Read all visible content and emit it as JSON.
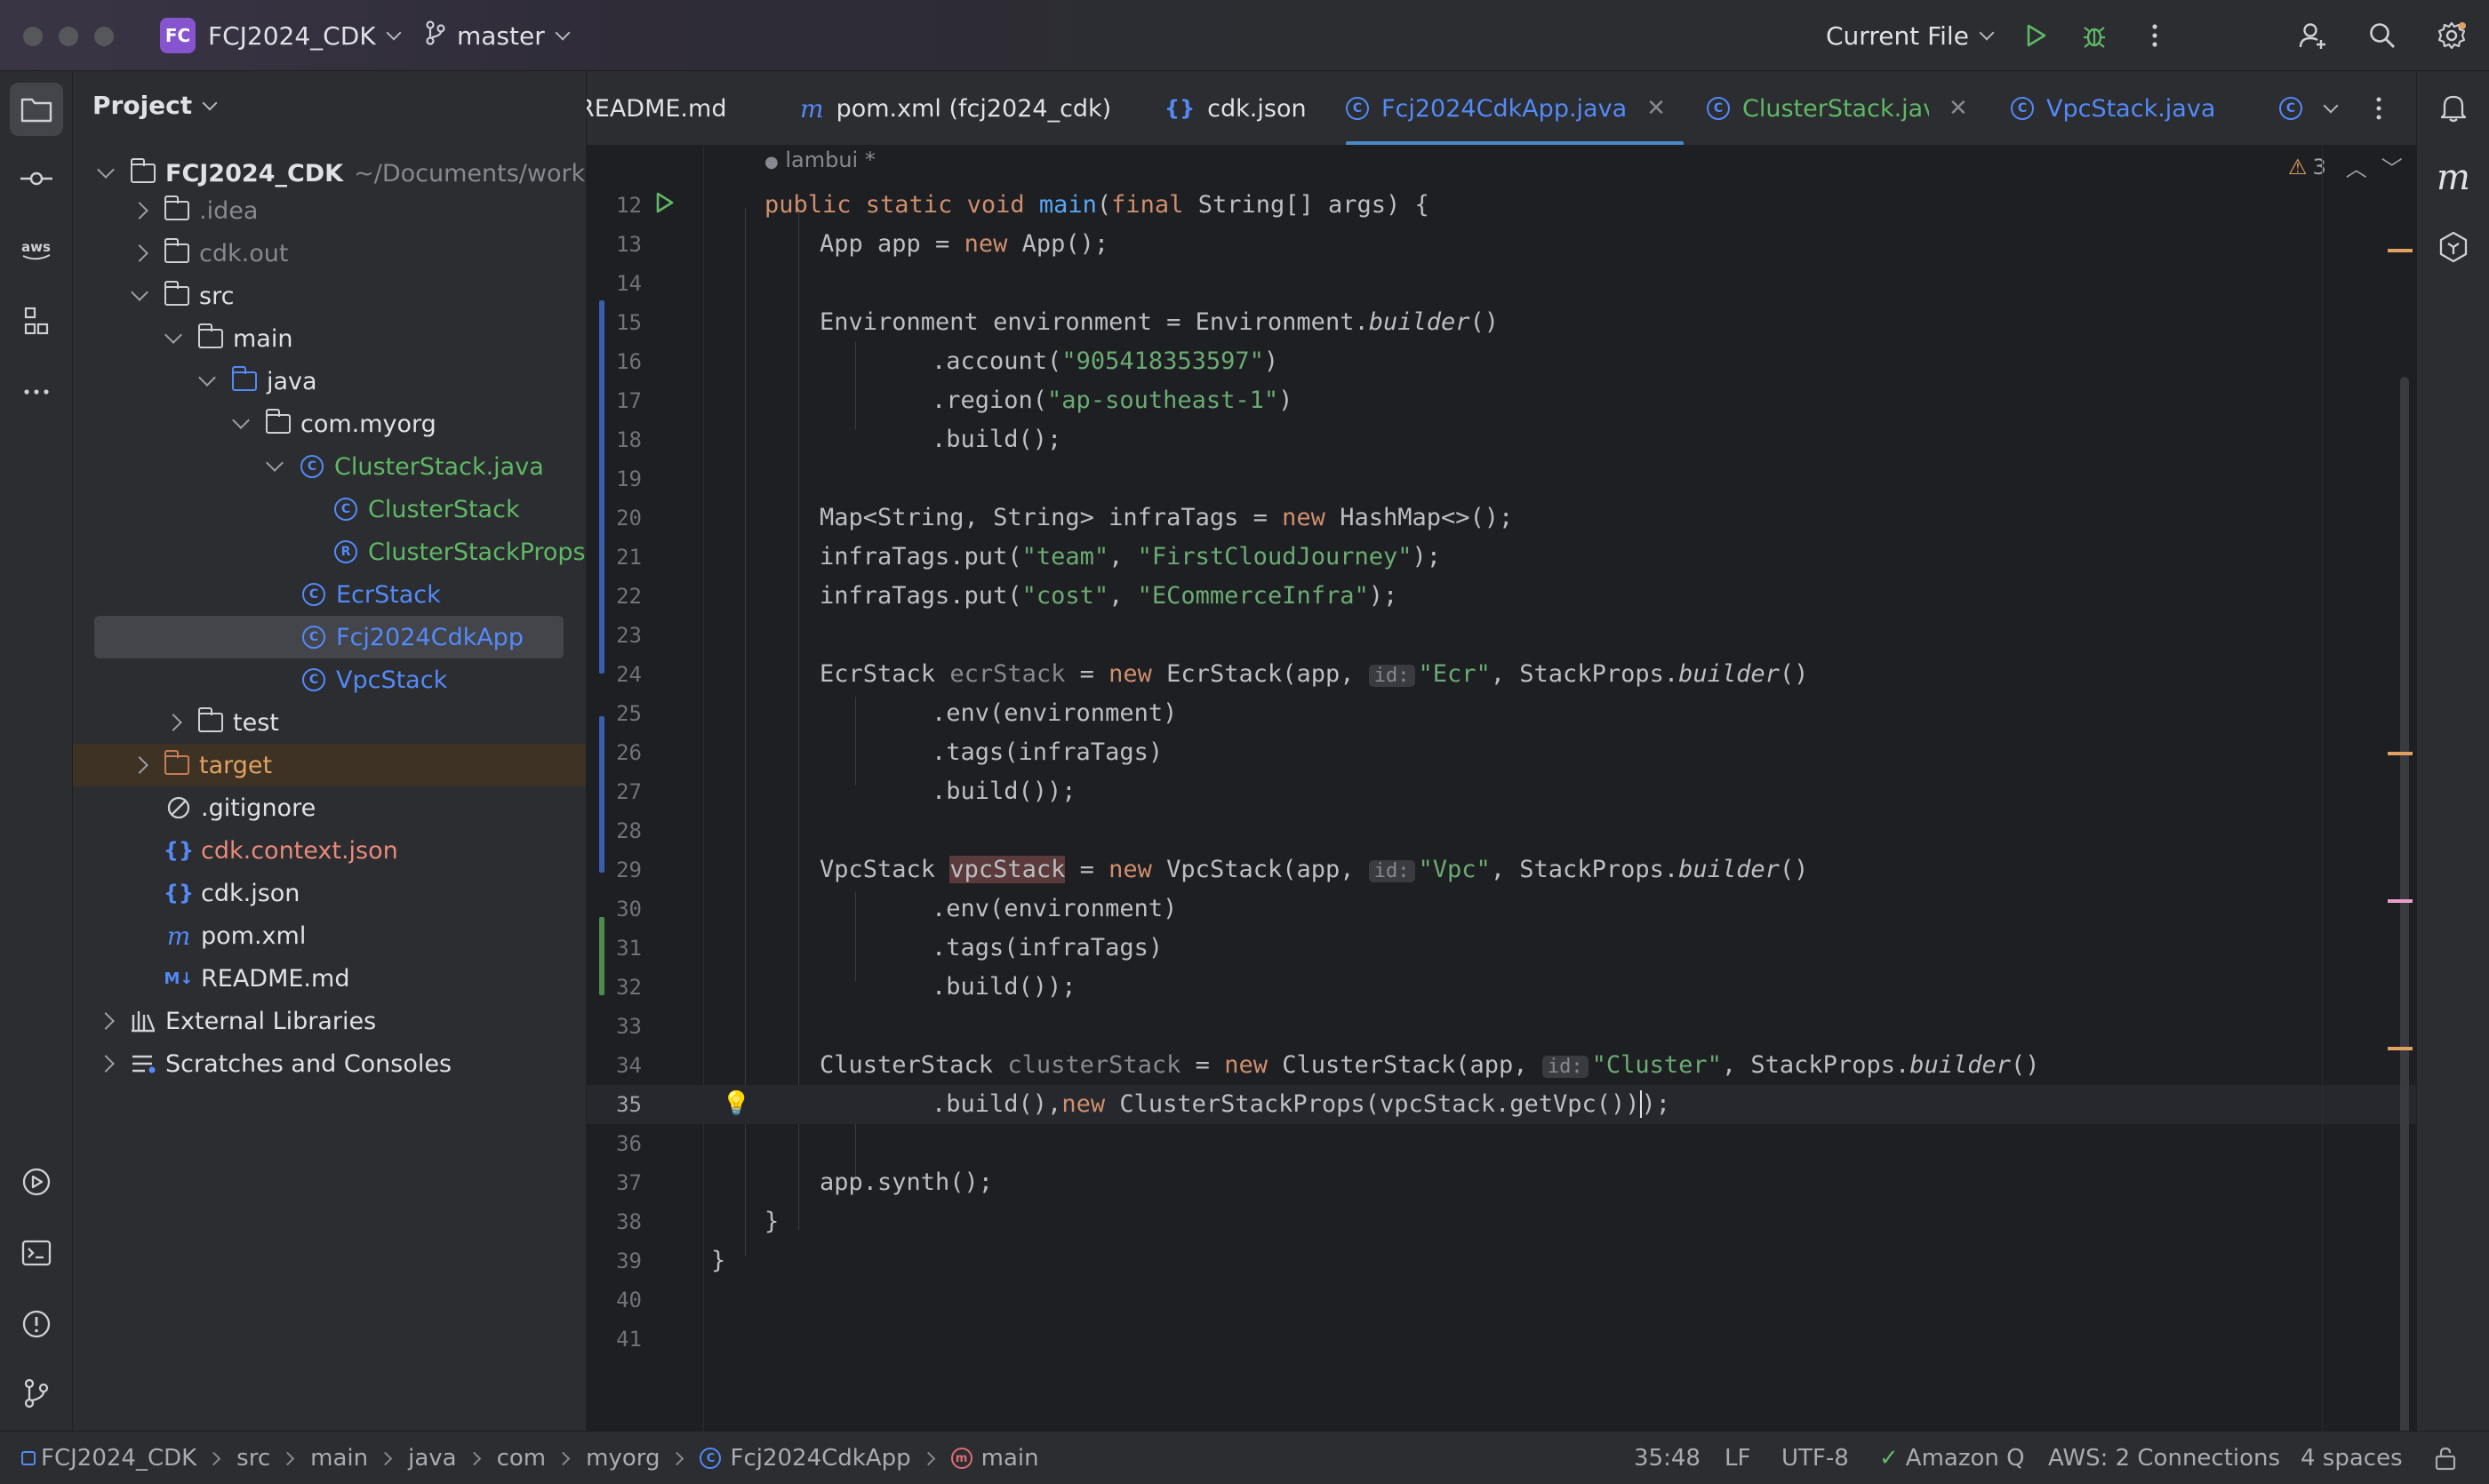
{
  "titlebar": {
    "project_badge": "FC",
    "project_name": "FCJ2024_CDK",
    "branch": "master",
    "run_config": "Current File"
  },
  "project_panel": {
    "title": "Project",
    "root_name": "FCJ2024_CDK",
    "root_path": "~/Documents/worksho",
    "items": [
      {
        "label": ".idea"
      },
      {
        "label": "cdk.out"
      },
      {
        "label": "src"
      },
      {
        "label": "main"
      },
      {
        "label": "java"
      },
      {
        "label": "com.myorg"
      },
      {
        "label": "ClusterStack.java"
      },
      {
        "label": "ClusterStack"
      },
      {
        "label": "ClusterStackProps"
      },
      {
        "label": "EcrStack"
      },
      {
        "label": "Fcj2024CdkApp"
      },
      {
        "label": "VpcStack"
      },
      {
        "label": "test"
      },
      {
        "label": "target"
      },
      {
        "label": ".gitignore"
      },
      {
        "label": "cdk.context.json"
      },
      {
        "label": "cdk.json"
      },
      {
        "label": "pom.xml"
      },
      {
        "label": "README.md"
      },
      {
        "label": "External Libraries"
      },
      {
        "label": "Scratches and Consoles"
      }
    ]
  },
  "tabs": [
    {
      "label": "README.md"
    },
    {
      "label": "pom.xml (fcj2024_cdk)"
    },
    {
      "label": "cdk.json"
    },
    {
      "label": "Fcj2024CdkApp.java"
    },
    {
      "label": "ClusterStack.java"
    },
    {
      "label": "VpcStack.java"
    }
  ],
  "editor": {
    "author_hint": "lambui *",
    "warnings_count": "3",
    "line_numbers": [
      "12",
      "13",
      "14",
      "15",
      "16",
      "17",
      "18",
      "19",
      "20",
      "21",
      "22",
      "23",
      "24",
      "25",
      "26",
      "27",
      "28",
      "29",
      "30",
      "31",
      "32",
      "33",
      "34",
      "35",
      "36",
      "37",
      "38",
      "39",
      "40",
      "41"
    ]
  },
  "statusbar": {
    "breadcrumbs": [
      "FCJ2024_CDK",
      "src",
      "main",
      "java",
      "com",
      "myorg",
      "Fcj2024CdkApp",
      "main"
    ],
    "cursor": "35:48",
    "line_sep": "LF",
    "encoding": "UTF-8",
    "amazon_q": "Amazon Q",
    "aws": "AWS: 2 Connections",
    "indent": "4 spaces"
  }
}
